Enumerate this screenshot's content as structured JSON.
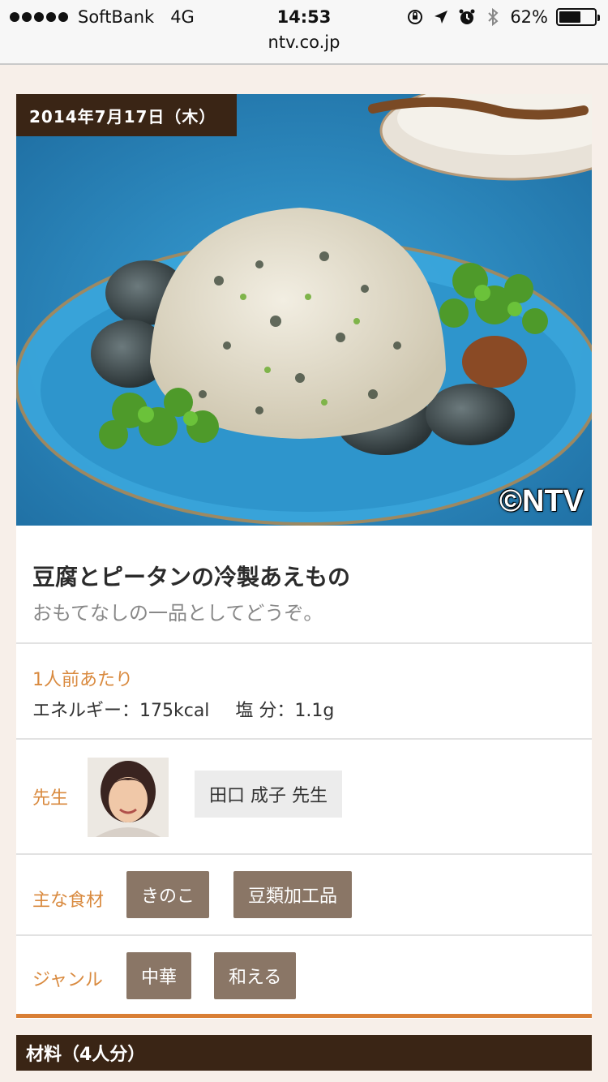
{
  "status_bar": {
    "carrier": "SoftBank",
    "network": "4G",
    "time": "14:53",
    "battery_text": "62%",
    "battery_level": 0.62,
    "url": "ntv.co.jp"
  },
  "recipe": {
    "date": "2014年7月17日（木）",
    "copyright": "©NTV",
    "title": "豆腐とピータンの冷製あえもの",
    "subtitle": "おもてなしの一品としてどうぞ。",
    "per_serving_label": "1人前あたり",
    "energy": "エネルギー：175kcal",
    "salt": "塩 分：1.1g",
    "teacher_label": "先生",
    "teacher_name": "田口 成子 先生",
    "ingredients_label": "主な食材",
    "ingredients_tags": [
      "きのこ",
      "豆類加工品"
    ],
    "genre_label": "ジャンル",
    "genre_tags": [
      "中華",
      "和える"
    ],
    "materials_header": "材料（4人分）"
  },
  "colors": {
    "accent_orange": "#d98a3f",
    "dark_brown": "#3a2515",
    "tag_brown": "#8a7666",
    "photo_blue": "#2b8fc6"
  }
}
